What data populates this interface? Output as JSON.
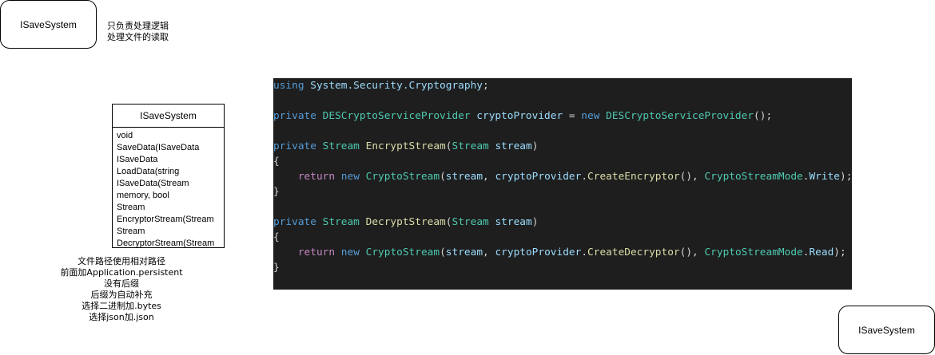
{
  "top_box": {
    "label": "ISaveSystem"
  },
  "top_note": {
    "lines": [
      "只负责处理逻辑",
      "处理文件的读取"
    ]
  },
  "uml": {
    "title": "ISaveSystem",
    "lines": [
      "void",
      "SaveData(ISaveData",
      "ISaveData",
      "LoadData(string",
      "ISaveData(Stream",
      "memory, bool",
      "Stream",
      "EncryptorStream(Stream",
      "Stream",
      "DecryptorStream(Stream"
    ]
  },
  "bottom_note": {
    "lines": [
      "文件路径使用相对路径",
      "前面加Application.persistent",
      "没有后缀",
      "后缀为自动补充",
      "选择二进制加.bytes",
      "选择json加.json"
    ]
  },
  "code": {
    "theme": {
      "background": "#1e1e1e",
      "keyword": "#569cd6",
      "type": "#4ec9b0",
      "function": "#dcdcaa",
      "control": "#c586c0",
      "identifier": "#9cdcfe",
      "plain": "#d4d4d4"
    },
    "lines": [
      [
        {
          "t": "kw",
          "v": "using"
        },
        {
          "t": "pl",
          "v": " "
        },
        {
          "t": "id",
          "v": "System.Security.Cryptography"
        },
        {
          "t": "pl",
          "v": ";"
        }
      ],
      [],
      [
        {
          "t": "kw",
          "v": "private"
        },
        {
          "t": "pl",
          "v": " "
        },
        {
          "t": "ty",
          "v": "DESCryptoServiceProvider"
        },
        {
          "t": "pl",
          "v": " "
        },
        {
          "t": "id",
          "v": "cryptoProvider"
        },
        {
          "t": "pl",
          "v": " = "
        },
        {
          "t": "kw",
          "v": "new"
        },
        {
          "t": "pl",
          "v": " "
        },
        {
          "t": "ty",
          "v": "DESCryptoServiceProvider"
        },
        {
          "t": "pl",
          "v": "();"
        }
      ],
      [],
      [
        {
          "t": "kw",
          "v": "private"
        },
        {
          "t": "pl",
          "v": " "
        },
        {
          "t": "ty",
          "v": "Stream"
        },
        {
          "t": "pl",
          "v": " "
        },
        {
          "t": "fn",
          "v": "EncryptStream"
        },
        {
          "t": "pl",
          "v": "("
        },
        {
          "t": "ty",
          "v": "Stream"
        },
        {
          "t": "pl",
          "v": " "
        },
        {
          "t": "id",
          "v": "stream"
        },
        {
          "t": "pl",
          "v": ")"
        }
      ],
      [
        {
          "t": "pl",
          "v": "{"
        }
      ],
      [
        {
          "t": "pl",
          "v": "    "
        },
        {
          "t": "ctl",
          "v": "return"
        },
        {
          "t": "pl",
          "v": " "
        },
        {
          "t": "kw",
          "v": "new"
        },
        {
          "t": "pl",
          "v": " "
        },
        {
          "t": "ty",
          "v": "CryptoStream"
        },
        {
          "t": "pl",
          "v": "("
        },
        {
          "t": "id",
          "v": "stream"
        },
        {
          "t": "pl",
          "v": ", "
        },
        {
          "t": "id",
          "v": "cryptoProvider"
        },
        {
          "t": "pl",
          "v": "."
        },
        {
          "t": "fn",
          "v": "CreateEncryptor"
        },
        {
          "t": "pl",
          "v": "(), "
        },
        {
          "t": "ty",
          "v": "CryptoStreamMode"
        },
        {
          "t": "pl",
          "v": "."
        },
        {
          "t": "id",
          "v": "Write"
        },
        {
          "t": "pl",
          "v": ");"
        }
      ],
      [
        {
          "t": "pl",
          "v": "}"
        }
      ],
      [],
      [
        {
          "t": "kw",
          "v": "private"
        },
        {
          "t": "pl",
          "v": " "
        },
        {
          "t": "ty",
          "v": "Stream"
        },
        {
          "t": "pl",
          "v": " "
        },
        {
          "t": "fn",
          "v": "DecryptStream"
        },
        {
          "t": "pl",
          "v": "("
        },
        {
          "t": "ty",
          "v": "Stream"
        },
        {
          "t": "pl",
          "v": " "
        },
        {
          "t": "id",
          "v": "stream"
        },
        {
          "t": "pl",
          "v": ")"
        }
      ],
      [
        {
          "t": "pl",
          "v": "{"
        }
      ],
      [
        {
          "t": "pl",
          "v": "    "
        },
        {
          "t": "ctl",
          "v": "return"
        },
        {
          "t": "pl",
          "v": " "
        },
        {
          "t": "kw",
          "v": "new"
        },
        {
          "t": "pl",
          "v": " "
        },
        {
          "t": "ty",
          "v": "CryptoStream"
        },
        {
          "t": "pl",
          "v": "("
        },
        {
          "t": "id",
          "v": "stream"
        },
        {
          "t": "pl",
          "v": ", "
        },
        {
          "t": "id",
          "v": "cryptoProvider"
        },
        {
          "t": "pl",
          "v": "."
        },
        {
          "t": "fn",
          "v": "CreateDecryptor"
        },
        {
          "t": "pl",
          "v": "(), "
        },
        {
          "t": "ty",
          "v": "CryptoStreamMode"
        },
        {
          "t": "pl",
          "v": "."
        },
        {
          "t": "id",
          "v": "Read"
        },
        {
          "t": "pl",
          "v": ");"
        }
      ],
      [
        {
          "t": "pl",
          "v": "}"
        }
      ]
    ]
  },
  "bottom_box": {
    "label": "ISaveSystem"
  }
}
